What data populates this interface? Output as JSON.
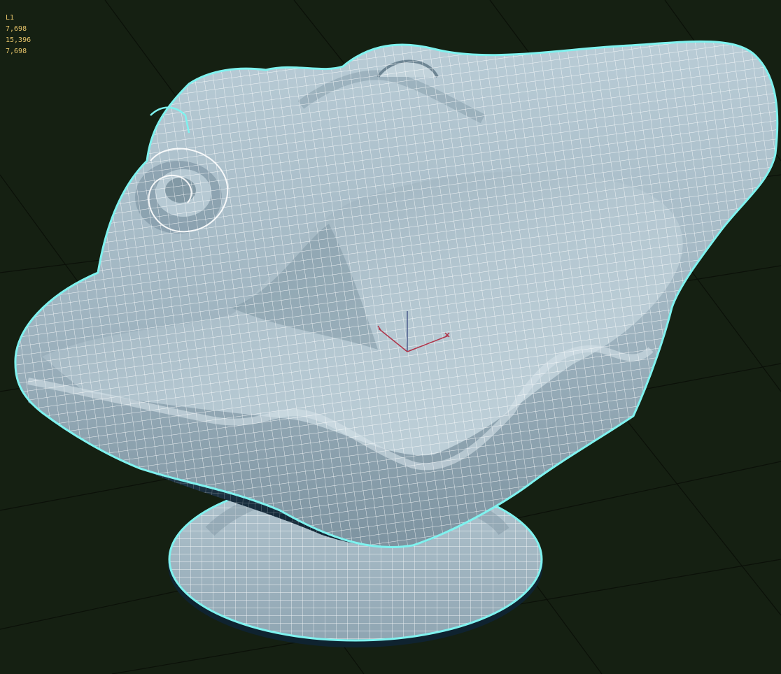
{
  "viewport": {
    "background": "#152012",
    "grid_color": "#0a0f08",
    "mesh_fill": "#a9bdc8",
    "mesh_shadow": "#0f2330",
    "wire_color": "#ffffff",
    "outline_color": "#7ff2ef"
  },
  "stats": {
    "label": "L1",
    "polys": "7,698",
    "tris": "15,396",
    "verts": "7,698"
  },
  "gizmo": {
    "x_axis_color": "#b0354a",
    "y_axis_color": "#b0354a",
    "z_axis_color": "#4a5a8a"
  }
}
